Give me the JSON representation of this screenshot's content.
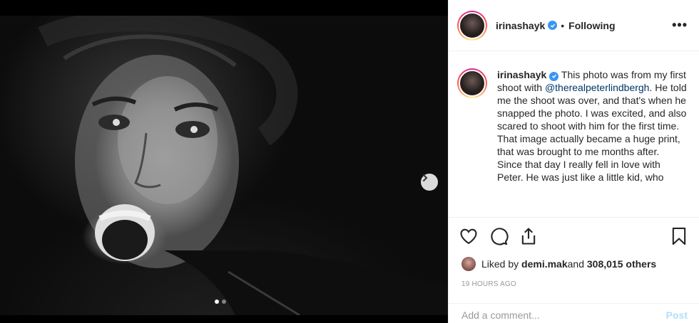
{
  "post": {
    "image_count": 2,
    "active_image": 1
  },
  "header": {
    "username": "irinashayk",
    "separator": "•",
    "follow_status": "Following",
    "more_label": "•••"
  },
  "caption": {
    "username": "irinashayk",
    "text_before_mention": " This photo was from my first shoot with ",
    "mention": "@therealpeterlindbergh",
    "text_after_mention": ". He told me the shoot was over, and that's when he snapped the photo. I was excited, and also scared to shoot with him for the first time. That image actually became a huge print, that was brought to me months after.",
    "text_paragraph_2": "Since that day I really fell in love with Peter. He was just like a little kid, who"
  },
  "likes": {
    "prefix": "Liked by ",
    "liker": "demi.mak",
    "middle": " and ",
    "count": "308,015 others"
  },
  "timestamp": "19 HOURS AGO",
  "comment": {
    "placeholder": "Add a comment...",
    "value": "",
    "post_label": "Post"
  },
  "colors": {
    "verified": "#3897f0",
    "mention": "#003569",
    "post_disabled": "#b2dffc",
    "muted": "#999999"
  }
}
